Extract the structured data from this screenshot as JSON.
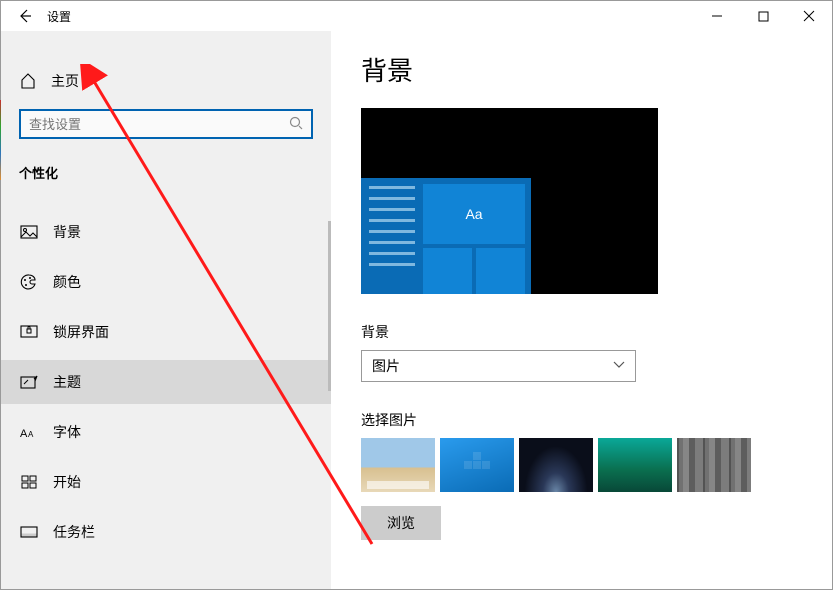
{
  "title": "设置",
  "home_label": "主页",
  "search_placeholder": "查找设置",
  "category": "个性化",
  "nav": [
    {
      "icon": "image-icon",
      "label": "背景"
    },
    {
      "icon": "palette-icon",
      "label": "颜色"
    },
    {
      "icon": "lock-icon",
      "label": "锁屏界面"
    },
    {
      "icon": "brush-icon",
      "label": "主题"
    },
    {
      "icon": "font-icon",
      "label": "字体"
    },
    {
      "icon": "start-icon",
      "label": "开始"
    },
    {
      "icon": "taskbar-icon",
      "label": "任务栏"
    }
  ],
  "selected_nav": 3,
  "content": {
    "heading": "背景",
    "bg_label": "背景",
    "bg_value": "图片",
    "select_label": "选择图片",
    "browse_label": "浏览",
    "preview_tile_text": "Aa"
  }
}
